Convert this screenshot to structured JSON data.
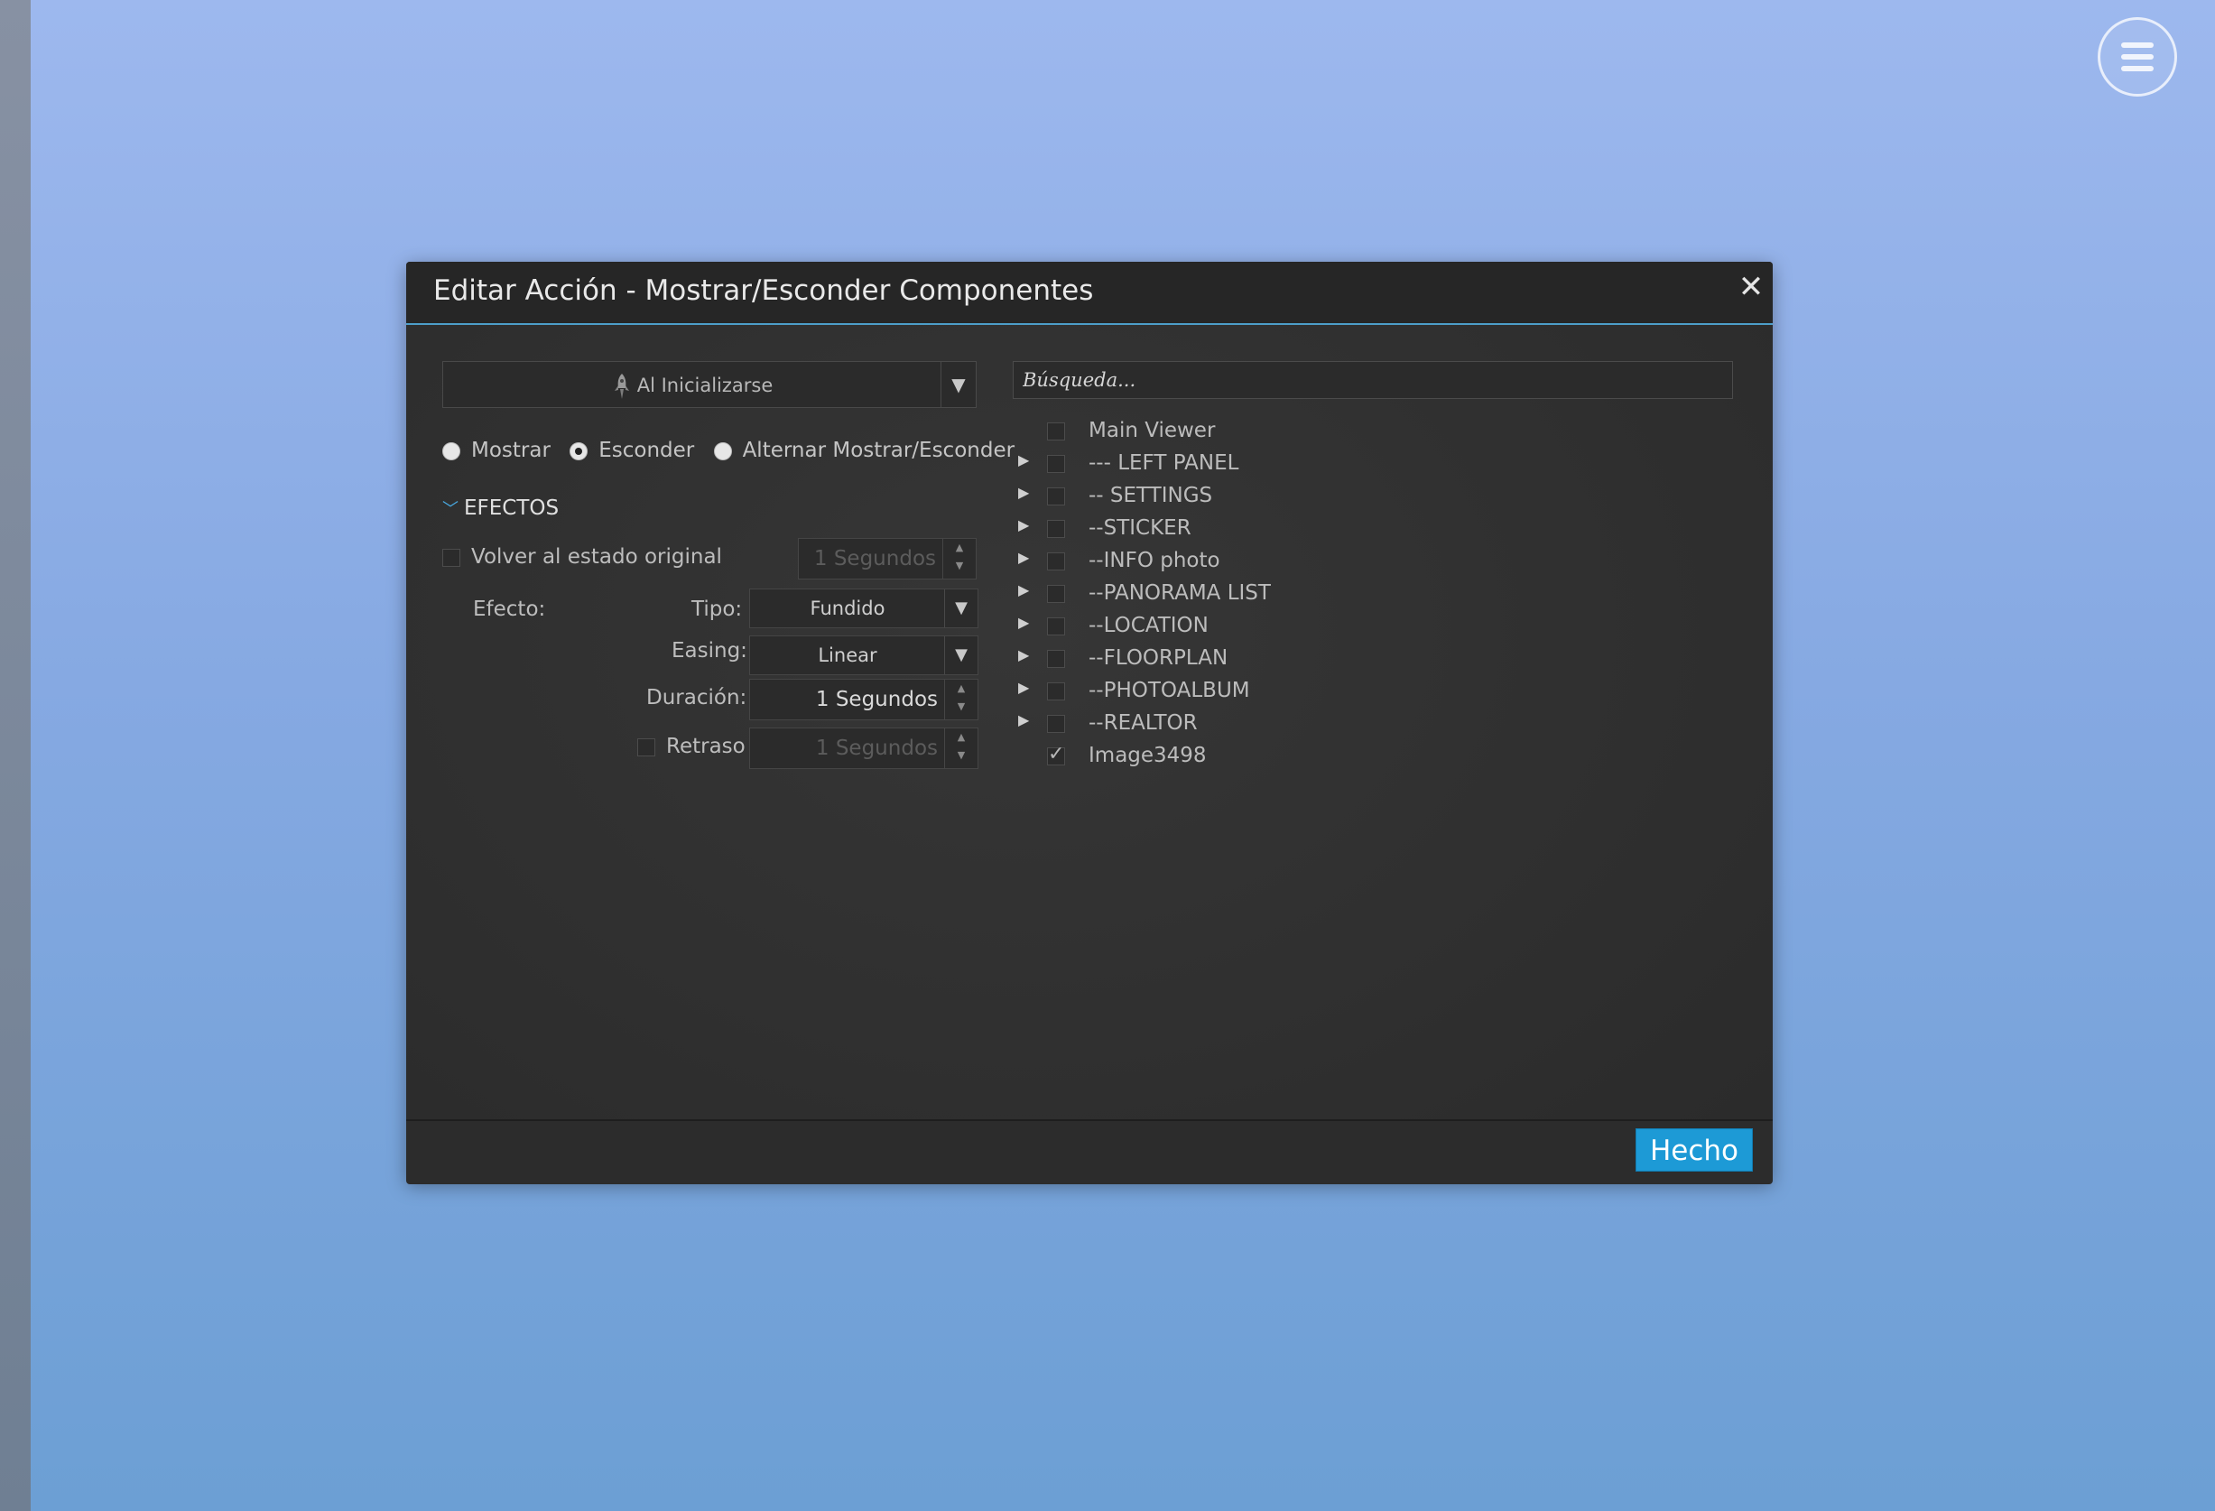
{
  "dialog": {
    "title": "Editar Acción - Mostrar/Esconder Componentes",
    "close_icon": "close-icon"
  },
  "event": {
    "selected": "Al Inicializarse",
    "icon": "rocket-icon"
  },
  "visibility_options": [
    {
      "label": "Mostrar",
      "selected": false
    },
    {
      "label": "Esconder",
      "selected": true
    },
    {
      "label": "Alternar Mostrar/Esconder",
      "selected": false
    }
  ],
  "effects": {
    "section_title": "EFECTOS",
    "revert_label": "Volver al estado original",
    "revert_checked": false,
    "revert_duration": "1 Segundos",
    "effect_label": "Efecto:",
    "type_label": "Tipo:",
    "type_value": "Fundido",
    "easing_label": "Easing:",
    "easing_value": "Linear",
    "duration_label": "Duración:",
    "duration_value": "1 Segundos",
    "delay_label": "Retraso",
    "delay_checked": false,
    "delay_value": "1 Segundos"
  },
  "search": {
    "placeholder": "Búsqueda..."
  },
  "tree": [
    {
      "label": "Main Viewer",
      "expandable": false,
      "checked": false
    },
    {
      "label": "--- LEFT PANEL",
      "expandable": true,
      "checked": false
    },
    {
      "label": "-- SETTINGS",
      "expandable": true,
      "checked": false
    },
    {
      "label": "--STICKER",
      "expandable": true,
      "checked": false
    },
    {
      "label": "--INFO photo",
      "expandable": true,
      "checked": false
    },
    {
      "label": "--PANORAMA LIST",
      "expandable": true,
      "checked": false
    },
    {
      "label": "--LOCATION",
      "expandable": true,
      "checked": false
    },
    {
      "label": "--FLOORPLAN",
      "expandable": true,
      "checked": false
    },
    {
      "label": "--PHOTOALBUM",
      "expandable": true,
      "checked": false
    },
    {
      "label": "--REALTOR",
      "expandable": true,
      "checked": false
    },
    {
      "label": "Image3498",
      "expandable": false,
      "checked": true
    }
  ],
  "footer": {
    "done_label": "Hecho"
  },
  "colors": {
    "accent": "#1d9ad6",
    "dialog_bg": "#2f2f2f",
    "header_line": "#4d9ec9"
  }
}
